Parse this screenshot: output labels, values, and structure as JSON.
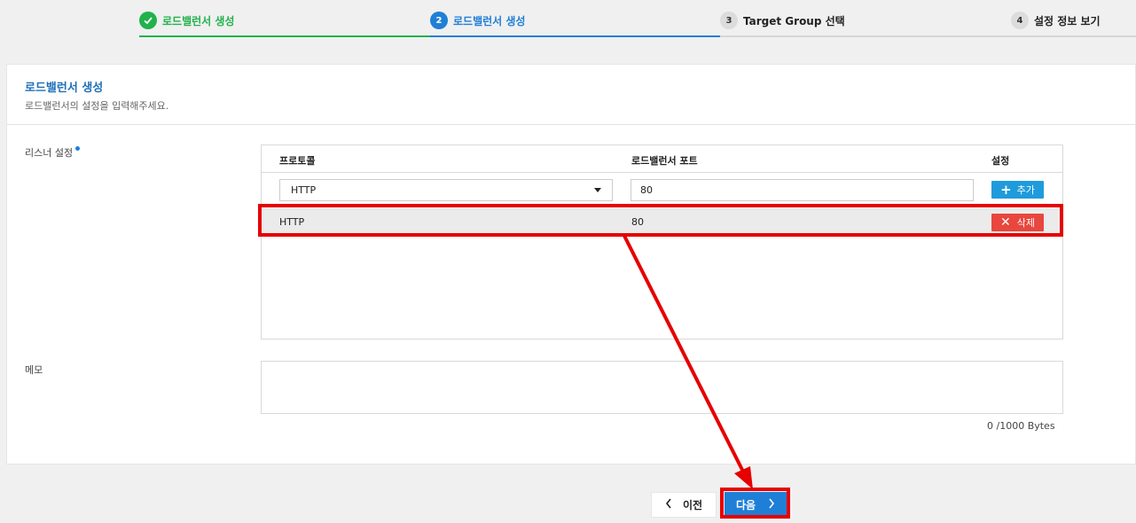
{
  "stepper": {
    "steps": [
      {
        "num": "",
        "label": "로드밸런서 생성",
        "state": "done"
      },
      {
        "num": "2",
        "label": "로드밸런서 생성",
        "state": "active"
      },
      {
        "num": "3",
        "label": "Target Group 선택",
        "state": "pending"
      },
      {
        "num": "4",
        "label": "설정 정보 보기",
        "state": "pending"
      }
    ]
  },
  "card": {
    "title": "로드밸런서 생성",
    "subtitle": "로드밸런서의 설정을 입력해주세요."
  },
  "listener": {
    "label": "리스너 설정",
    "columns": [
      "프로토콜",
      "로드밸런서 포트",
      "설정"
    ],
    "protocol_select": "HTTP",
    "port_input": "80",
    "add_label": "추가",
    "rows": [
      {
        "protocol": "HTTP",
        "port": "80",
        "delete_label": "삭제"
      }
    ]
  },
  "memo": {
    "label": "메모",
    "value": "",
    "counter": "0 /1000 Bytes"
  },
  "buttons": {
    "prev_label": "이전",
    "next_label": "다음"
  },
  "colors": {
    "done": "#21b24b",
    "active": "#1f7fd6",
    "annotation": "#e60000"
  }
}
